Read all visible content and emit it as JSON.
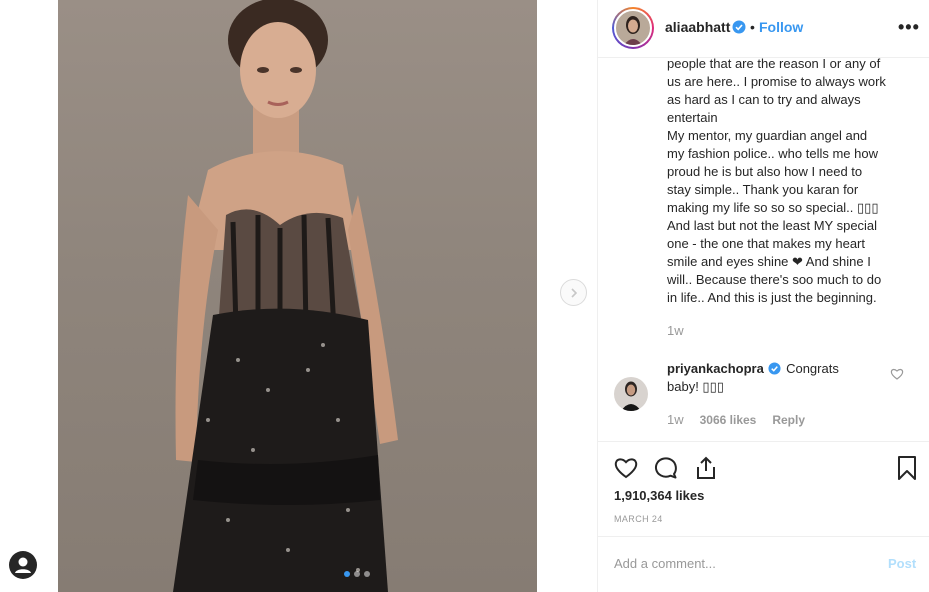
{
  "post": {
    "username": "aliaabhatt",
    "separator": "•",
    "follow_label": "Follow",
    "more_label": "•••",
    "caption_lines": [
      "people that are the reason I or any of",
      "us are here.. I promise to always work",
      "as hard as I can to try and always",
      "entertain",
      "My mentor, my guardian angel and",
      "my fashion police.. who tells me how",
      "proud he is but also how I need to",
      "stay simple.. Thank you karan for",
      "making my life so so so special.. ▯▯▯",
      "And last but not the least MY special",
      "one - the one that makes my heart",
      "smile and eyes shine ❤ And shine I",
      "will.. Because there's soo much to do",
      "in life.. And this is just the beginning."
    ],
    "caption_time": "1w",
    "likes": "1,910,364 likes",
    "date": "MARCH 24",
    "comment_placeholder": "Add a comment...",
    "post_label": "Post"
  },
  "comment": {
    "username": "priyankachopra",
    "text_first": "Congrats",
    "text_second": "baby! ▯▯▯",
    "time": "1w",
    "likes": "3066 likes",
    "reply_label": "Reply"
  },
  "carousel": {
    "slide_count": 3,
    "active_index": 0
  },
  "colors": {
    "accent": "#3897f0",
    "muted": "#999999",
    "border": "#efefef"
  }
}
